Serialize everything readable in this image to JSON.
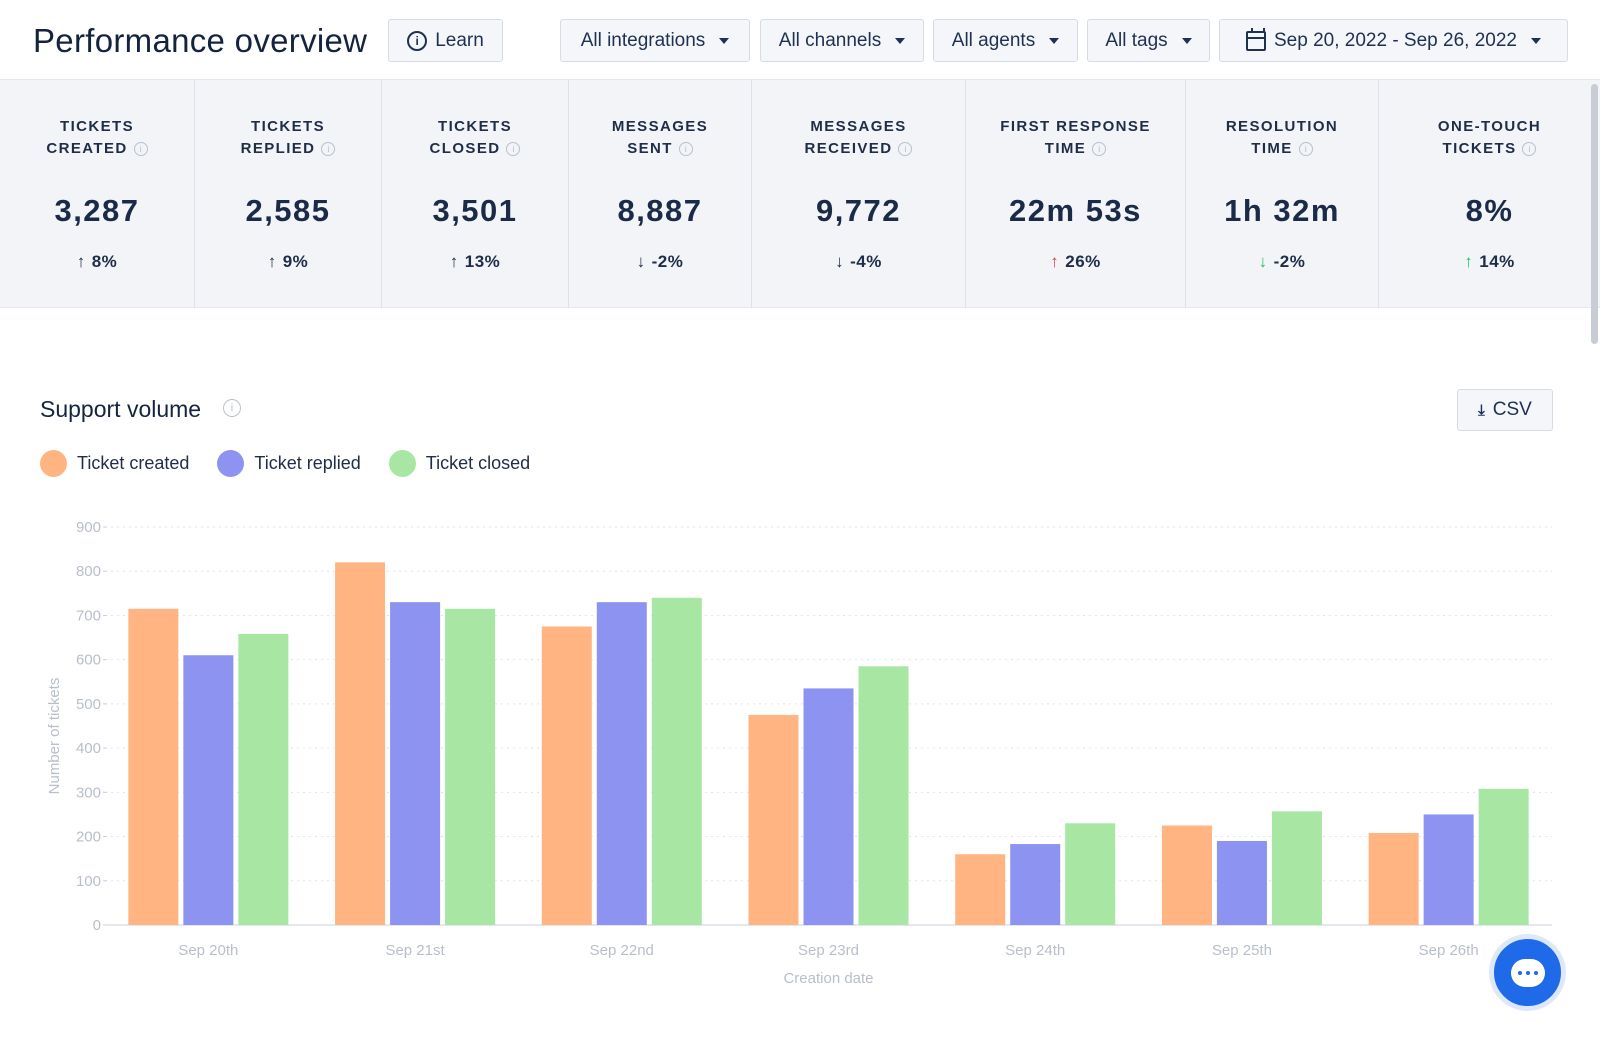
{
  "header": {
    "title": "Performance overview",
    "learn_label": "Learn",
    "filters": {
      "integrations": "All integrations",
      "channels": "All channels",
      "agents": "All agents",
      "tags": "All tags",
      "date_range": "Sep 20, 2022 - Sep 26, 2022"
    }
  },
  "stats": [
    {
      "line1": "TICKETS",
      "line2": "CREATED",
      "value": "3,287",
      "direction": "up",
      "change": "8%",
      "color": "neutral"
    },
    {
      "line1": "TICKETS",
      "line2": "REPLIED",
      "value": "2,585",
      "direction": "up",
      "change": "9%",
      "color": "neutral"
    },
    {
      "line1": "TICKETS",
      "line2": "CLOSED",
      "value": "3,501",
      "direction": "up",
      "change": "13%",
      "color": "neutral"
    },
    {
      "line1": "MESSAGES",
      "line2": "SENT",
      "value": "8,887",
      "direction": "down",
      "change": "-2%",
      "color": "neutral"
    },
    {
      "line1": "MESSAGES",
      "line2": "RECEIVED",
      "value": "9,772",
      "direction": "down",
      "change": "-4%",
      "color": "neutral"
    },
    {
      "line1": "FIRST RESPONSE",
      "line2": "TIME",
      "value": "22m 53s",
      "direction": "up",
      "change": "26%",
      "color": "red"
    },
    {
      "line1": "RESOLUTION",
      "line2": "TIME",
      "value": "1h 32m",
      "direction": "down",
      "change": "-2%",
      "color": "green"
    },
    {
      "line1": "ONE-TOUCH",
      "line2": "TICKETS",
      "value": "8%",
      "direction": "up",
      "change": "14%",
      "color": "green"
    }
  ],
  "support_volume": {
    "title": "Support volume",
    "csv_label": "CSV"
  },
  "colors": {
    "created": "#ffb482",
    "replied": "#8d93f0",
    "closed": "#a8e6a3",
    "accent": "#1f6ae8"
  },
  "chart_data": {
    "type": "bar",
    "categories": [
      "Sep 20th",
      "Sep 21st",
      "Sep 22nd",
      "Sep 23rd",
      "Sep 24th",
      "Sep 25th",
      "Sep 26th"
    ],
    "series": [
      {
        "name": "Ticket created",
        "values": [
          715,
          820,
          675,
          475,
          160,
          225,
          208
        ]
      },
      {
        "name": "Ticket replied",
        "values": [
          610,
          730,
          730,
          535,
          183,
          190,
          250
        ]
      },
      {
        "name": "Ticket closed",
        "values": [
          658,
          715,
          740,
          585,
          230,
          257,
          308
        ]
      }
    ],
    "xlabel": "Creation date",
    "ylabel": "Number of tickets",
    "ylim": [
      0,
      900
    ],
    "yticks": [
      0,
      100,
      200,
      300,
      400,
      500,
      600,
      700,
      800,
      900
    ],
    "grid": true,
    "legend": "top-left"
  }
}
